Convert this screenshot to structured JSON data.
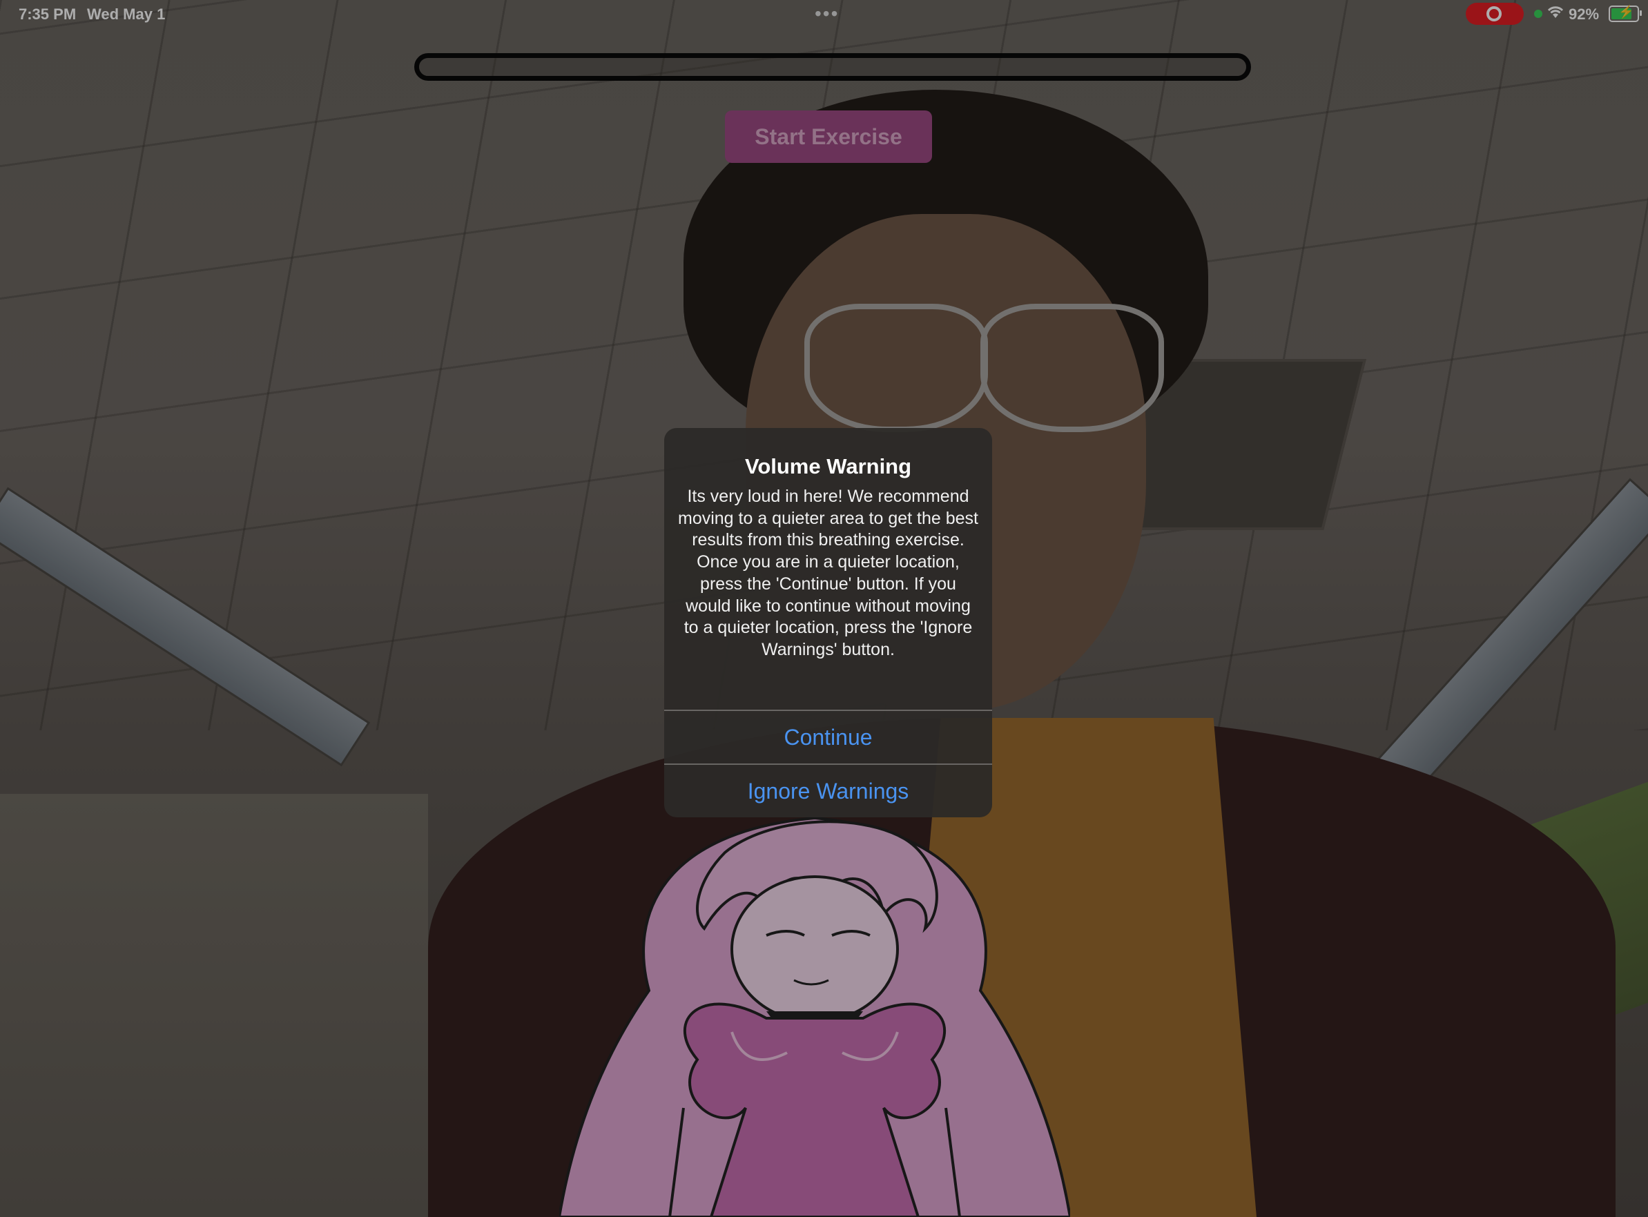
{
  "status_bar": {
    "time": "7:35 PM",
    "date": "Wed May 1",
    "more_icon": "•••",
    "recording_indicator": "screen-recording-icon",
    "wifi_icon": "wifi-icon",
    "battery_percent": "92%",
    "battery_level": 0.92,
    "charging": true
  },
  "progress": {
    "value": 0.0
  },
  "start_button": {
    "label": "Start Exercise"
  },
  "alert": {
    "title": "Volume Warning",
    "message": "Its very loud in here! We recommend moving to a quieter area to get the best results from this breathing exercise. Once you are in a quieter location, press the 'Continue' button. If you would like to continue without moving to a quieter location, press the 'Ignore Warnings' button.",
    "buttons": [
      {
        "label": "Continue"
      },
      {
        "label": "Ignore Warnings"
      }
    ]
  },
  "colors": {
    "accent_pink": "#c05aa3",
    "button_pink": "#9c4a83",
    "alert_link_blue": "#4a93f0",
    "record_red": "#e31e24"
  }
}
